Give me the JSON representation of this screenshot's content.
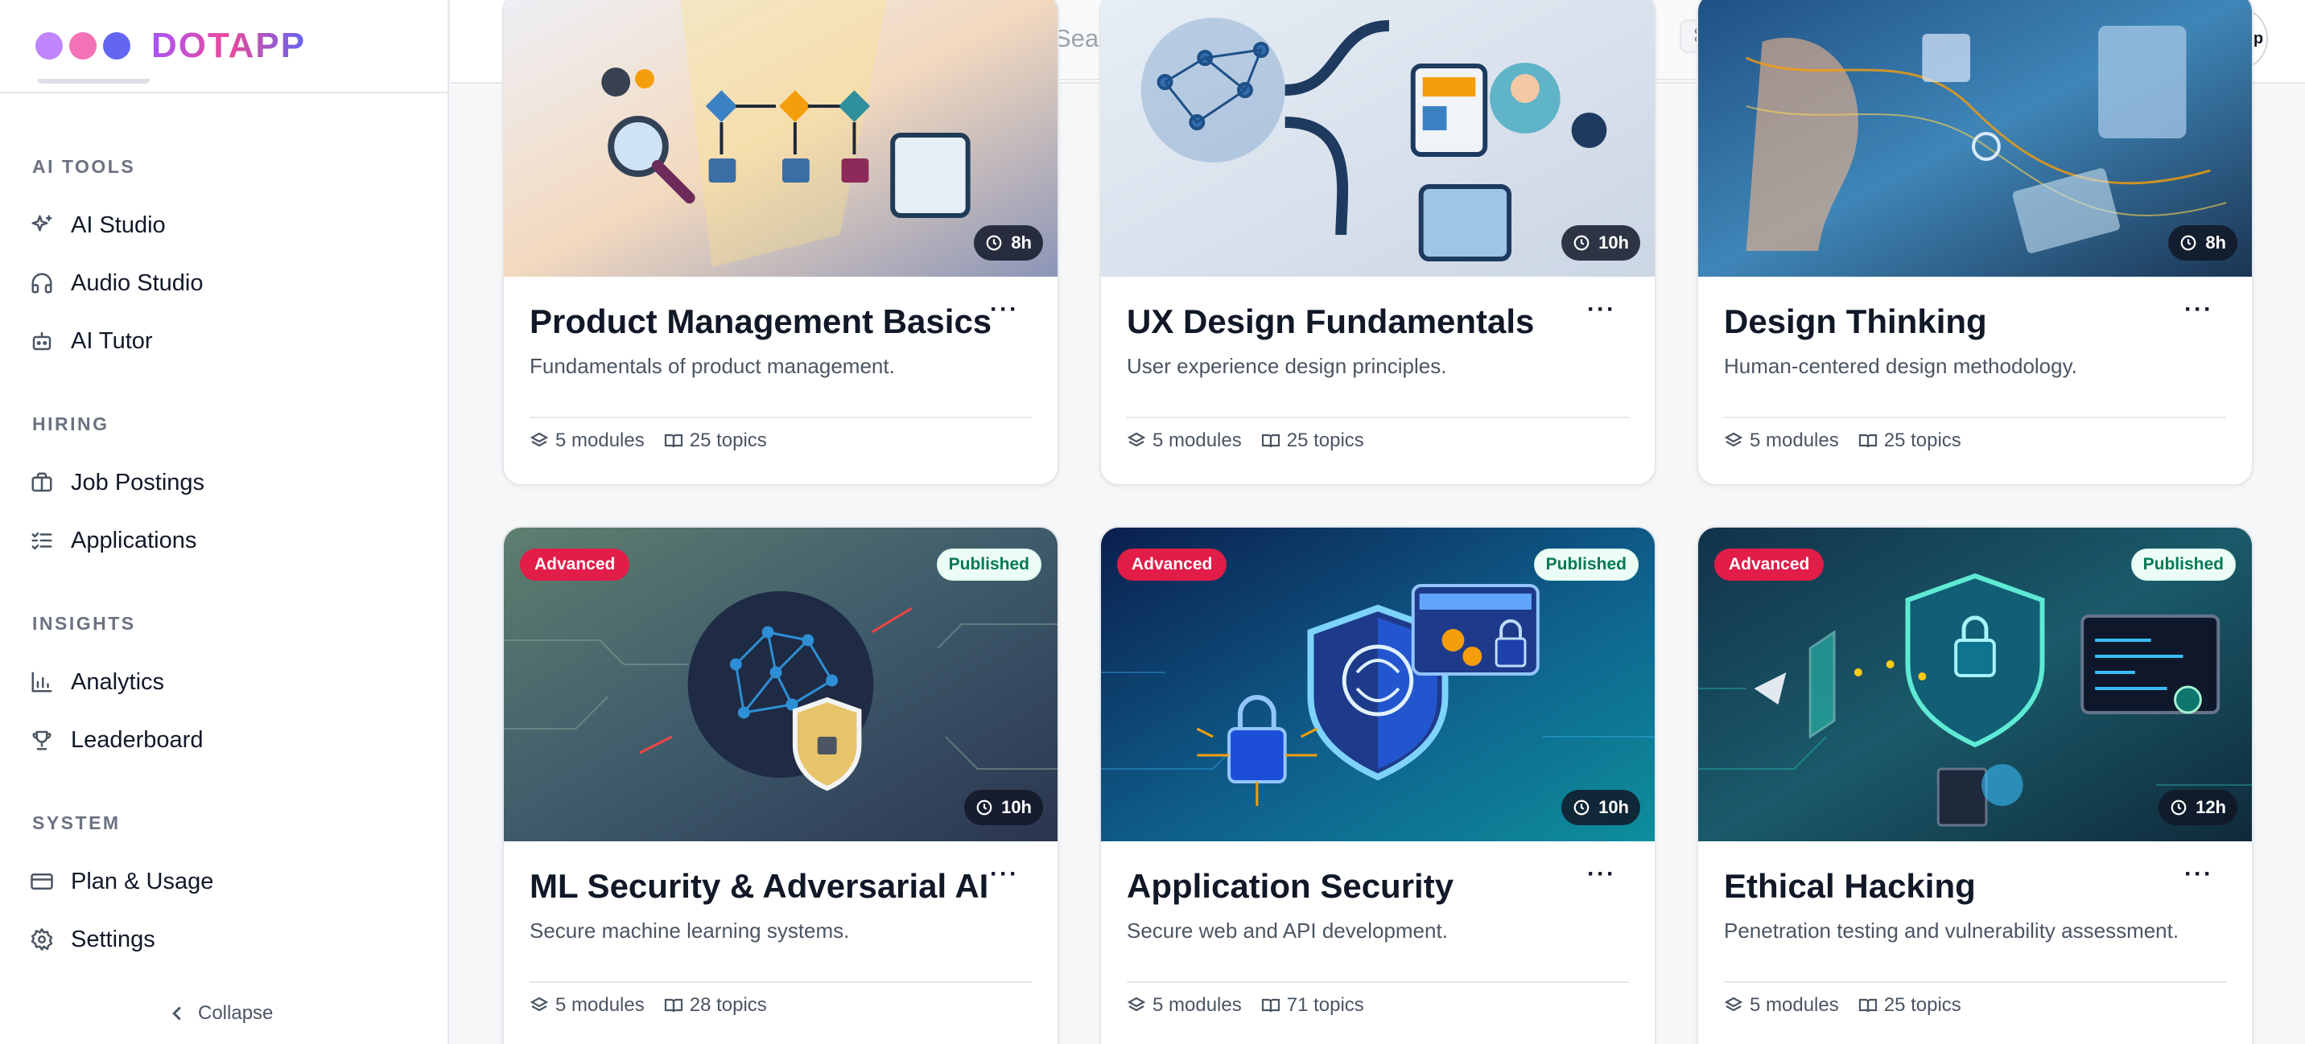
{
  "app": {
    "brand": "DOTAPP",
    "brand_dots": [
      "#c084fc",
      "#f472b6",
      "#6366f1"
    ],
    "avatar_text": "DotApp"
  },
  "sidebar": {
    "sections": [
      {
        "label": "AI TOOLS",
        "items": [
          {
            "label": "AI Studio",
            "icon": "sparkles-icon"
          },
          {
            "label": "Audio Studio",
            "icon": "headphones-icon"
          },
          {
            "label": "AI Tutor",
            "icon": "bot-icon"
          }
        ]
      },
      {
        "label": "HIRING",
        "items": [
          {
            "label": "Job Postings",
            "icon": "briefcase-icon"
          },
          {
            "label": "Applications",
            "icon": "list-checks-icon"
          }
        ]
      },
      {
        "label": "INSIGHTS",
        "items": [
          {
            "label": "Analytics",
            "icon": "bar-chart-icon"
          },
          {
            "label": "Leaderboard",
            "icon": "trophy-icon"
          }
        ]
      },
      {
        "label": "SYSTEM",
        "items": [
          {
            "label": "Plan & Usage",
            "icon": "credit-card-icon"
          },
          {
            "label": "Settings",
            "icon": "gear-icon"
          }
        ]
      }
    ],
    "collapse_label": "Collapse"
  },
  "header": {
    "search_placeholder": "Search courses, topics...",
    "shortcut": "⌘ K"
  },
  "colors": {
    "advanced_badge": "#e11d48",
    "published_badge_text": "#047857"
  },
  "courses": [
    {
      "title": "Product Management Basics",
      "description": "Fundamentals of product management.",
      "duration": "8h",
      "modules": "5 modules",
      "topics": "25 topics"
    },
    {
      "title": "UX Design Fundamentals",
      "description": "User experience design principles.",
      "duration": "10h",
      "modules": "5 modules",
      "topics": "25 topics"
    },
    {
      "title": "Design Thinking",
      "description": "Human-centered design methodology.",
      "duration": "8h",
      "modules": "5 modules",
      "topics": "25 topics"
    },
    {
      "title": "ML Security & Adversarial AI",
      "description": "Secure machine learning systems.",
      "duration": "10h",
      "level": "Advanced",
      "status": "Published",
      "modules": "5 modules",
      "topics": "28 topics"
    },
    {
      "title": "Application Security",
      "description": "Secure web and API development.",
      "duration": "10h",
      "level": "Advanced",
      "status": "Published",
      "modules": "5 modules",
      "topics": "71 topics"
    },
    {
      "title": "Ethical Hacking",
      "description": "Penetration testing and vulnerability assessment.",
      "duration": "12h",
      "level": "Advanced",
      "status": "Published",
      "modules": "5 modules",
      "topics": "25 topics"
    }
  ]
}
